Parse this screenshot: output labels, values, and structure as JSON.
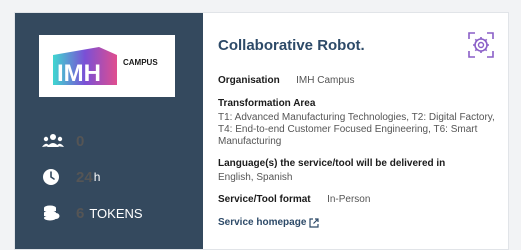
{
  "logo": {
    "brand_text": "IMH",
    "campus_text": "CAMPUS"
  },
  "stats": {
    "participants": {
      "value": "0",
      "icon": "users-icon"
    },
    "duration": {
      "value": "24",
      "unit": "h",
      "icon": "clock-icon"
    },
    "tokens": {
      "value": "6",
      "unit": "TOKENS",
      "icon": "coins-icon"
    }
  },
  "service": {
    "title": "Collaborative Robot.",
    "organisation_label": "Organisation",
    "organisation_value": "IMH Campus",
    "transformation_label": "Transformation Area",
    "transformation_value": "T1: Advanced Manufacturing Technologies, T2: Digital Factory, T4: End-to-end Customer Focused Engineering, T6: Smart Manufacturing",
    "language_label": "Language(s) the service/tool will be delivered in",
    "language_value": "English, Spanish",
    "format_label": "Service/Tool format",
    "format_value": "In-Person",
    "homepage_label": "Service homepage"
  },
  "colors": {
    "sidebar": "#34495e",
    "title": "#2d4a68",
    "settings_icon": "#8a5fc7"
  }
}
